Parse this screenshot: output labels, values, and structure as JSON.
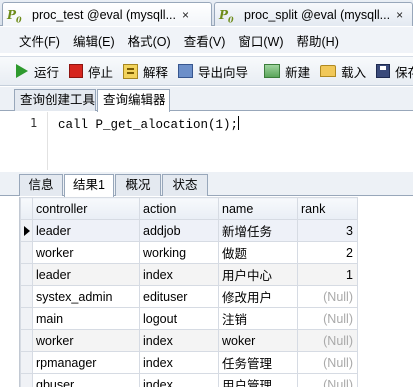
{
  "window_tabs": [
    {
      "label": "proc_test @eval (mysqll...",
      "close": "×"
    },
    {
      "label": "proc_split @eval (mysqll...",
      "close": "×"
    }
  ],
  "menu": [
    "文件(F)",
    "编辑(E)",
    "格式(O)",
    "查看(V)",
    "窗口(W)",
    "帮助(H)"
  ],
  "toolbar": {
    "run": "运行",
    "stop": "停止",
    "explain": "解释",
    "export": "导出向导",
    "new": "新建",
    "load": "载入",
    "save": "保存"
  },
  "editor_tabs": [
    "查询创建工具",
    "查询编辑器"
  ],
  "editor": {
    "line_number": "1",
    "code": "call P_get_alocation(1);"
  },
  "result_tabs": [
    "信息",
    "结果1",
    "概况",
    "状态"
  ],
  "grid": {
    "columns": [
      "controller",
      "action",
      "name",
      "rank"
    ],
    "rows": [
      {
        "controller": "leader",
        "action": "addjob",
        "name": "新增任务",
        "rank": "3"
      },
      {
        "controller": "worker",
        "action": "working",
        "name": "做题",
        "rank": "2"
      },
      {
        "controller": "leader",
        "action": "index",
        "name": "用户中心",
        "rank": "1"
      },
      {
        "controller": "systex_admin",
        "action": "edituser",
        "name": "修改用户",
        "rank": "(Null)"
      },
      {
        "controller": "main",
        "action": "logout",
        "name": "注销",
        "rank": "(Null)"
      },
      {
        "controller": "worker",
        "action": "index",
        "name": "woker",
        "rank": "(Null)"
      },
      {
        "controller": "rpmanager",
        "action": "index",
        "name": "任务管理",
        "rank": "(Null)"
      },
      {
        "controller": "qbuser",
        "action": "index",
        "name": "用户管理",
        "rank": "(Null)"
      }
    ]
  },
  "colors": {
    "accent_tab_border": "#98a7ba",
    "null_text": "#a9a9a9",
    "run_green": "#2e9a2e",
    "stop_red": "#d6261f"
  }
}
